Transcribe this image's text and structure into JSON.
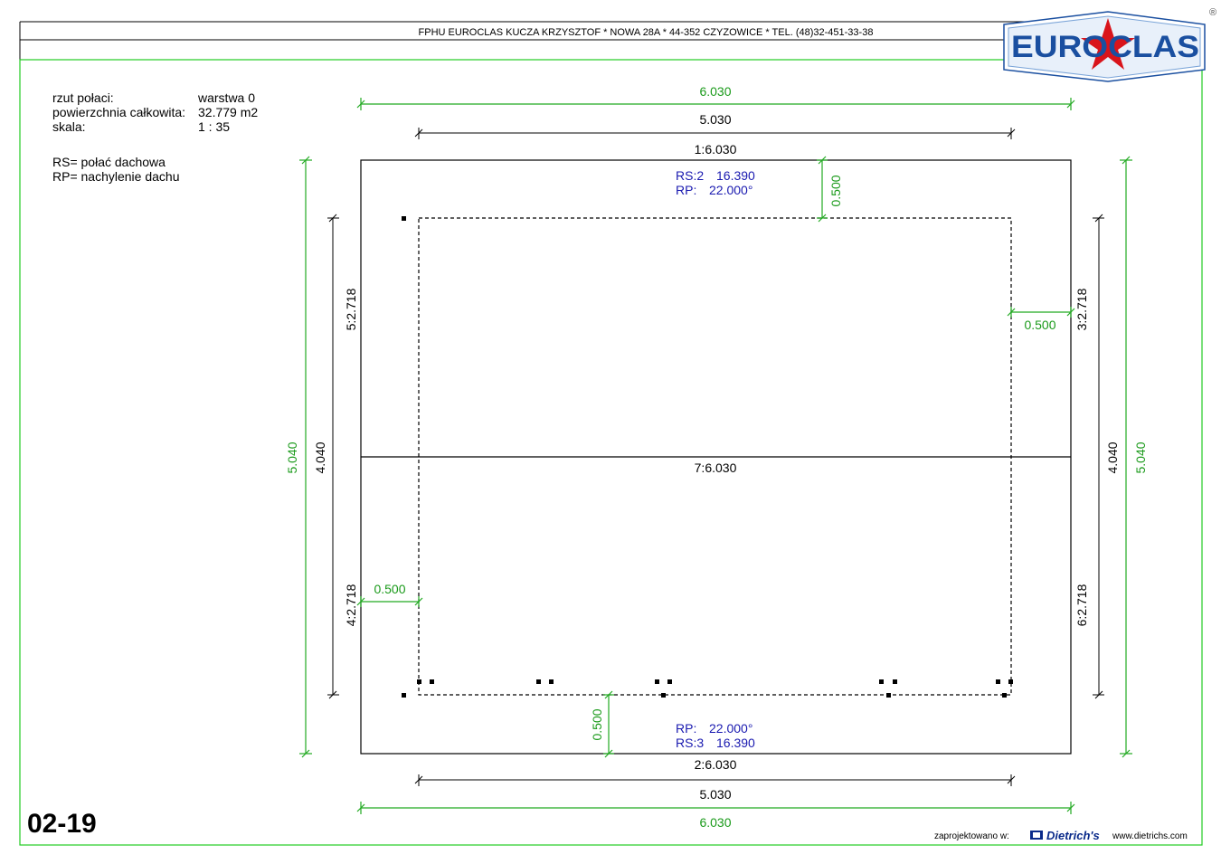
{
  "header": {
    "company_line": "FPHU EUROCLAS KUCZA KRZYSZTOF * NOWA 28A * 44-352 CZYZOWICE * TEL. (48)32-451-33-38",
    "logo_text": "EUROCLAS",
    "registered_mark": "®"
  },
  "info": {
    "rows": [
      {
        "label": "rzut połaci:",
        "value": "warstwa 0"
      },
      {
        "label": "powierzchnia całkowita:",
        "value": "32.779 m2"
      },
      {
        "label": "skala:",
        "value": "1 : 35"
      }
    ],
    "legend": [
      "RS= połać dachowa",
      "RP= nachylenie dachu"
    ]
  },
  "dimensions": {
    "top_outer": "6.030",
    "top_inner": "5.030",
    "edge_top": "1:6.030",
    "ridge": "7:6.030",
    "edge_bottom": "2:6.030",
    "bottom_inner": "5.030",
    "bottom_outer": "6.030",
    "left_outer": "5.040",
    "left_inner": "4.040",
    "right_inner": "4.040",
    "right_outer": "5.040",
    "edge_left_top": "5:2.718",
    "edge_left_bottom": "4:2.718",
    "edge_right_top": "3:2.718",
    "edge_right_bottom": "6:2.718",
    "overhang_top": "0.500",
    "overhang_right": "0.500",
    "overhang_left": "0.500",
    "overhang_bottom": "0.500"
  },
  "slopes": {
    "top": {
      "rs": "RS:2",
      "rs_value": "16.390",
      "rp": "RP:",
      "rp_value": "22.000°"
    },
    "bottom": {
      "rs": "RS:3",
      "rs_value": "16.390",
      "rp": "RP:",
      "rp_value": "22.000°"
    }
  },
  "footer": {
    "drawing_code": "02-19",
    "designed_in": "zaprojektowano w:",
    "software": "Dietrich's",
    "website": "www.dietrichs.com"
  },
  "colors": {
    "dimension_green": "#22aa22",
    "slope_blue": "#1a1ab0",
    "logo_blue": "#1a4fa0",
    "logo_star": "#d9141b"
  }
}
